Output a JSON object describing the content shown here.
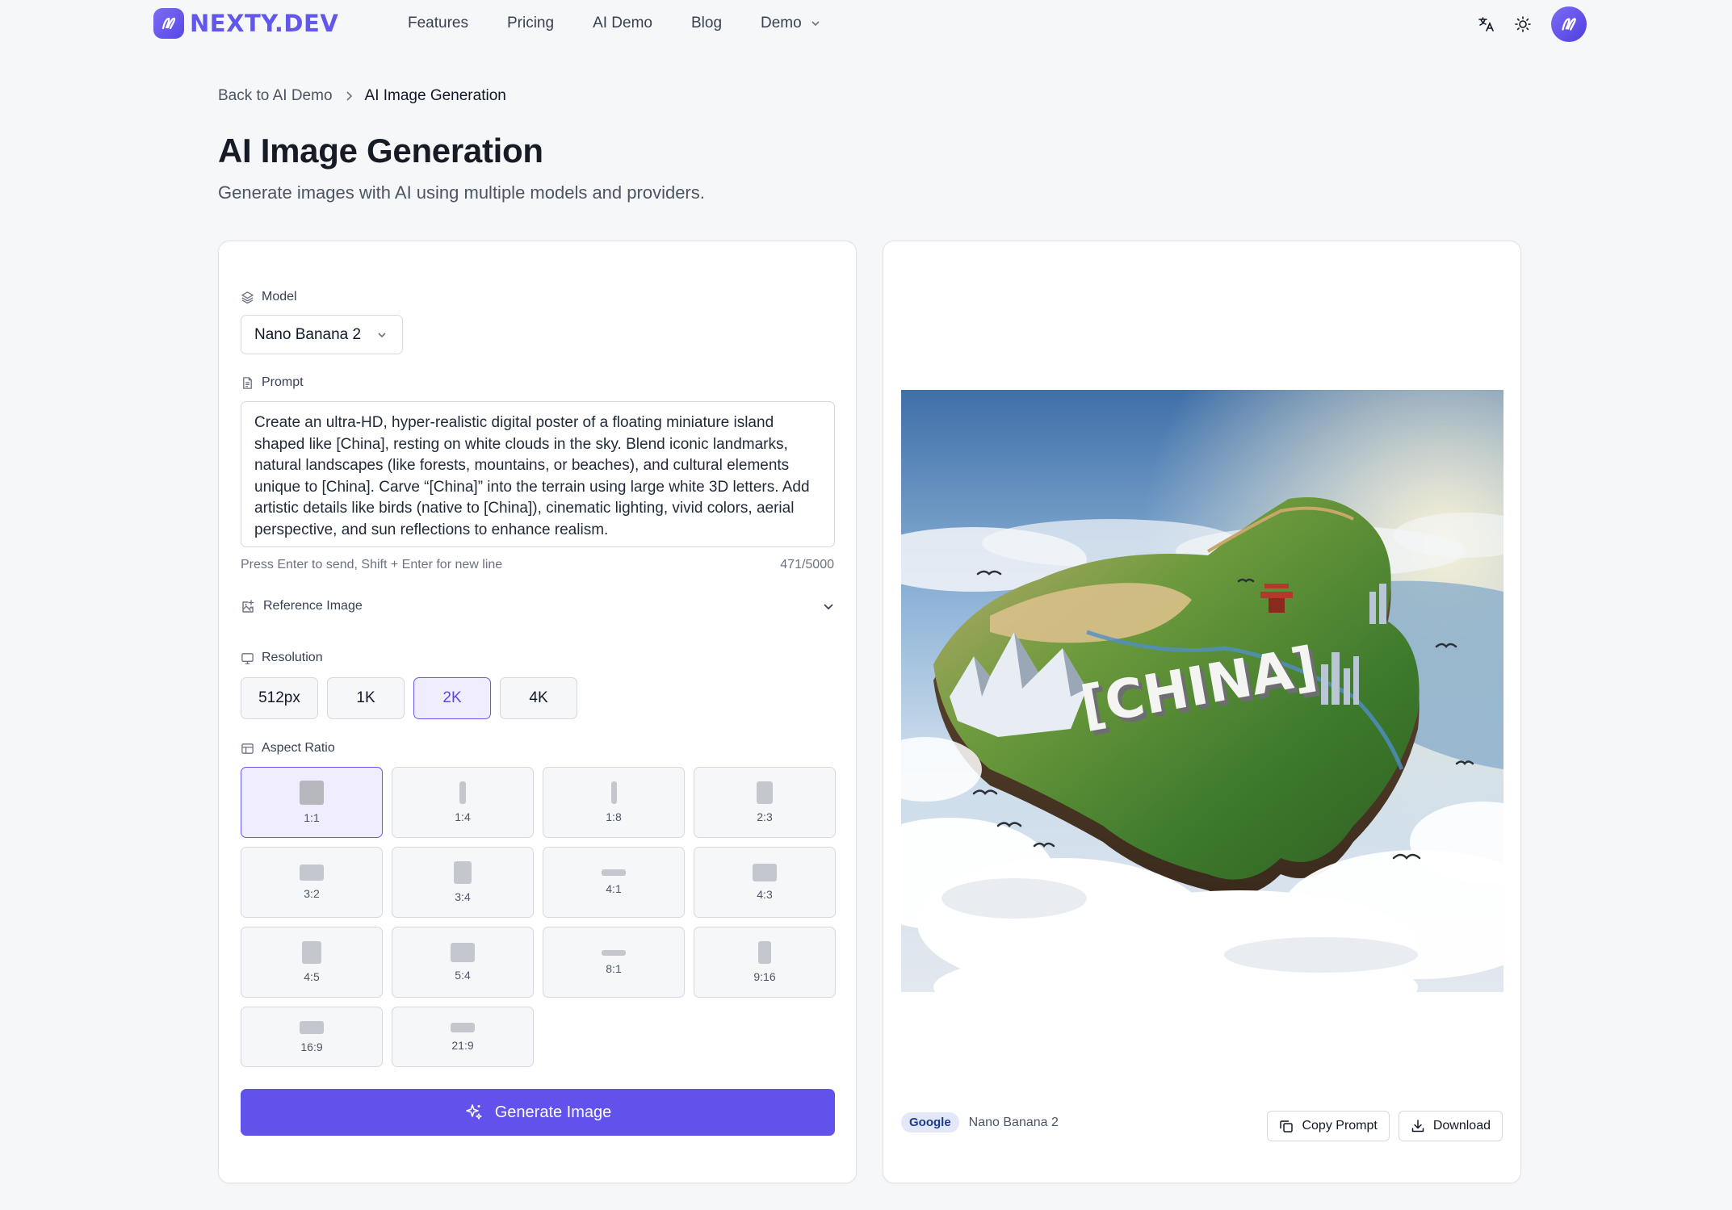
{
  "header": {
    "brand": "NEXTY.DEV",
    "nav": [
      {
        "label": "Features"
      },
      {
        "label": "Pricing"
      },
      {
        "label": "AI Demo"
      },
      {
        "label": "Blog"
      },
      {
        "label": "Demo"
      }
    ]
  },
  "breadcrumb": {
    "back": "Back to AI Demo",
    "current": "AI Image Generation"
  },
  "page": {
    "title": "AI Image Generation",
    "subtitle": "Generate images with AI using multiple models and providers."
  },
  "form": {
    "model_label": "Model",
    "model_value": "Nano Banana 2",
    "prompt_label": "Prompt",
    "prompt_value": "Create an ultra-HD, hyper-realistic digital poster of a floating miniature island shaped like [China], resting on white clouds in the sky. Blend iconic landmarks, natural landscapes (like forests, mountains, or beaches), and cultural elements unique to [China]. Carve “[China]” into the terrain using large white 3D letters. Add artistic details like birds (native to [China]), cinematic lighting, vivid colors, aerial perspective, and sun reflections to enhance realism.",
    "hint": "Press Enter to send, Shift + Enter for new line",
    "counter": "471/5000",
    "reference_label": "Reference Image",
    "resolution_label": "Resolution",
    "resolutions": [
      "512px",
      "1K",
      "2K",
      "4K"
    ],
    "selected_resolution": "2K",
    "aspect_label": "Aspect Ratio",
    "aspect_ratios": [
      "1:1",
      "1:4",
      "1:8",
      "2:3",
      "3:2",
      "3:4",
      "4:1",
      "4:3",
      "4:5",
      "5:4",
      "8:1",
      "9:16",
      "16:9",
      "21:9"
    ],
    "selected_aspect": "1:1",
    "generate_label": "Generate Image"
  },
  "result": {
    "image_text": "[CHINA]",
    "provider": "Google",
    "model": "Nano Banana 2",
    "copy_label": "Copy Prompt",
    "download_label": "Download"
  },
  "colors": {
    "accent": "#6052ea",
    "accent_light": "#efedfe",
    "page_bg": "#f6f7f9"
  }
}
